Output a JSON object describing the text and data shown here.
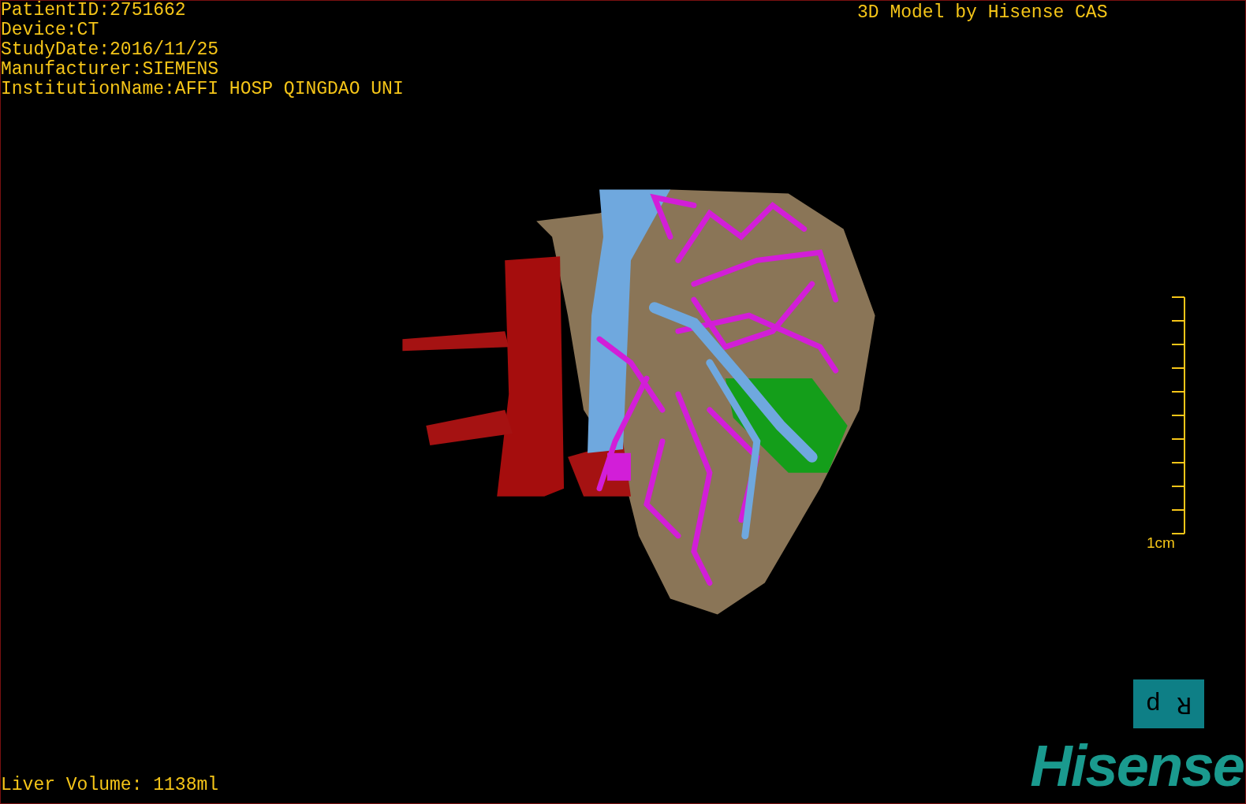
{
  "study_info": [
    "PatientID:2751662",
    "Device:CT",
    "StudyDate:2016/11/25",
    "Manufacturer:SIEMENS",
    "InstitutionName:AFFI HOSP QINGDAO UNI"
  ],
  "credit": "3D Model by Hisense CAS",
  "scale_bar": {
    "label": "1cm"
  },
  "orientation_marker": [
    "d",
    "R"
  ],
  "liver_volume": "Liver Volume: 1138ml",
  "logo": "Hisense"
}
